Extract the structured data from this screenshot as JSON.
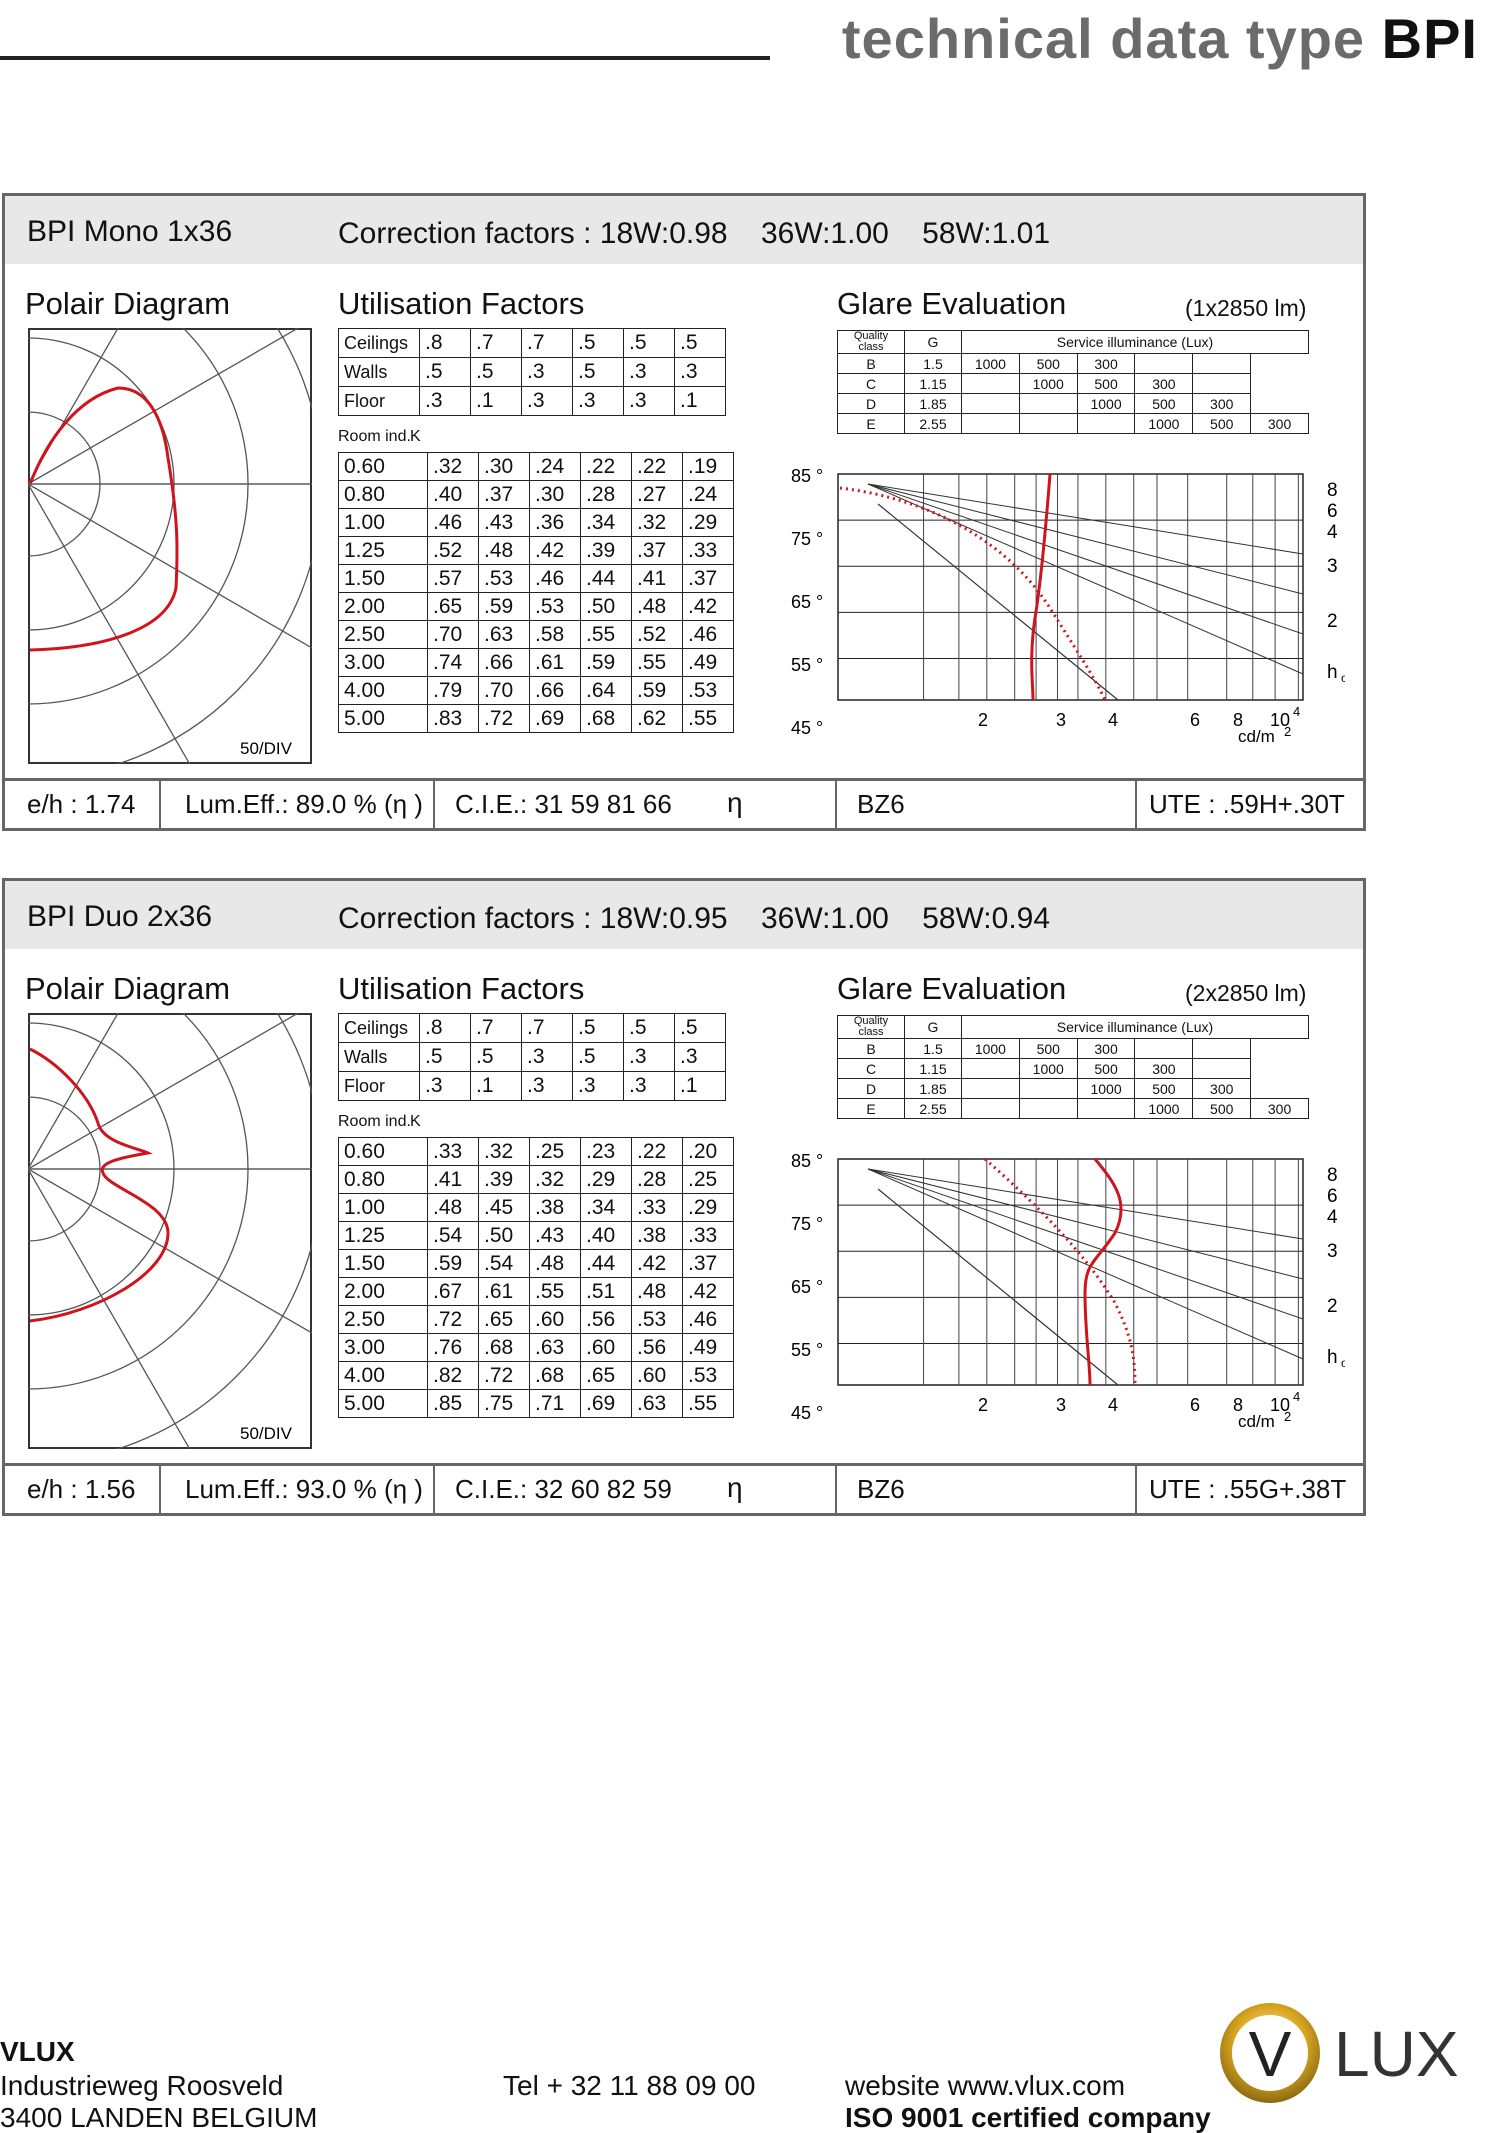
{
  "header": {
    "title_prefix": "technical data type",
    "title_bold": "BPI"
  },
  "panels": [
    {
      "name": "BPI Mono 1x36",
      "correction": "Correction factors : 18W:0.98    36W:1.00    58W:1.01",
      "polar_title": "Polair Diagram",
      "polar_scale": "50/DIV",
      "uf_title": "Utilisation Factors",
      "ceilings": [
        ".8",
        ".7",
        ".7",
        ".5",
        ".5",
        ".5"
      ],
      "walls": [
        ".5",
        ".5",
        ".3",
        ".5",
        ".3",
        ".3"
      ],
      "floor": [
        ".3",
        ".1",
        ".3",
        ".3",
        ".3",
        ".1"
      ],
      "rows": [
        {
          "k": "0.60",
          "v": [
            ".32",
            ".30",
            ".24",
            ".22",
            ".22",
            ".19"
          ]
        },
        {
          "k": "0.80",
          "v": [
            ".40",
            ".37",
            ".30",
            ".28",
            ".27",
            ".24"
          ]
        },
        {
          "k": "1.00",
          "v": [
            ".46",
            ".43",
            ".36",
            ".34",
            ".32",
            ".29"
          ]
        },
        {
          "k": "1.25",
          "v": [
            ".52",
            ".48",
            ".42",
            ".39",
            ".37",
            ".33"
          ]
        },
        {
          "k": "1.50",
          "v": [
            ".57",
            ".53",
            ".46",
            ".44",
            ".41",
            ".37"
          ]
        },
        {
          "k": "2.00",
          "v": [
            ".65",
            ".59",
            ".53",
            ".50",
            ".48",
            ".42"
          ]
        },
        {
          "k": "2.50",
          "v": [
            ".70",
            ".63",
            ".58",
            ".55",
            ".52",
            ".46"
          ]
        },
        {
          "k": "3.00",
          "v": [
            ".74",
            ".66",
            ".61",
            ".59",
            ".55",
            ".49"
          ]
        },
        {
          "k": "4.00",
          "v": [
            ".79",
            ".70",
            ".66",
            ".64",
            ".59",
            ".53"
          ]
        },
        {
          "k": "5.00",
          "v": [
            ".83",
            ".72",
            ".69",
            ".68",
            ".62",
            ".55"
          ]
        }
      ],
      "glare_title": "Glare Evaluation",
      "glare_lm": "(1x2850 lm)",
      "eh": "e/h : 1.74",
      "lumeff": "Lum.Eff.: 89.0 % (η )",
      "cie": "C.I.E.: 31 59 81 66",
      "eta": "η",
      "bz": "BZ6",
      "ute": "UTE : .59H+.30T"
    },
    {
      "name": "BPI Duo 2x36",
      "correction": "Correction factors : 18W:0.95    36W:1.00    58W:0.94",
      "polar_title": "Polair Diagram",
      "polar_scale": "50/DIV",
      "uf_title": "Utilisation Factors",
      "ceilings": [
        ".8",
        ".7",
        ".7",
        ".5",
        ".5",
        ".5"
      ],
      "walls": [
        ".5",
        ".5",
        ".3",
        ".5",
        ".3",
        ".3"
      ],
      "floor": [
        ".3",
        ".1",
        ".3",
        ".3",
        ".3",
        ".1"
      ],
      "rows": [
        {
          "k": "0.60",
          "v": [
            ".33",
            ".32",
            ".25",
            ".23",
            ".22",
            ".20"
          ]
        },
        {
          "k": "0.80",
          "v": [
            ".41",
            ".39",
            ".32",
            ".29",
            ".28",
            ".25"
          ]
        },
        {
          "k": "1.00",
          "v": [
            ".48",
            ".45",
            ".38",
            ".34",
            ".33",
            ".29"
          ]
        },
        {
          "k": "1.25",
          "v": [
            ".54",
            ".50",
            ".43",
            ".40",
            ".38",
            ".33"
          ]
        },
        {
          "k": "1.50",
          "v": [
            ".59",
            ".54",
            ".48",
            ".44",
            ".42",
            ".37"
          ]
        },
        {
          "k": "2.00",
          "v": [
            ".67",
            ".61",
            ".55",
            ".51",
            ".48",
            ".42"
          ]
        },
        {
          "k": "2.50",
          "v": [
            ".72",
            ".65",
            ".60",
            ".56",
            ".53",
            ".46"
          ]
        },
        {
          "k": "3.00",
          "v": [
            ".76",
            ".68",
            ".63",
            ".60",
            ".56",
            ".49"
          ]
        },
        {
          "k": "4.00",
          "v": [
            ".82",
            ".72",
            ".68",
            ".65",
            ".60",
            ".53"
          ]
        },
        {
          "k": "5.00",
          "v": [
            ".85",
            ".75",
            ".71",
            ".69",
            ".63",
            ".55"
          ]
        }
      ],
      "glare_title": "Glare Evaluation",
      "glare_lm": "(2x2850 lm)",
      "eh": "e/h : 1.56",
      "lumeff": "Lum.Eff.: 93.0 % (η )",
      "cie": "C.I.E.: 32 60 82 59",
      "eta": "η",
      "bz": "BZ6",
      "ute": "UTE : .55G+.38T"
    }
  ],
  "common": {
    "ceilings_label": "Ceilings",
    "walls_label": "Walls",
    "floor_label": "Floor",
    "room_index": "Room ind.",
    "k_label": "K",
    "ge_quality": "Quality class",
    "ge_g": "G",
    "ge_service": "Service illuminance (Lux)",
    "ge_rows": [
      {
        "c": "B",
        "g": "1.5",
        "a": "1000",
        "b": "500",
        "d": "300",
        "e": "",
        "f": ""
      },
      {
        "c": "C",
        "g": "1.15",
        "a": "",
        "b": "1000",
        "d": "500",
        "e": "300",
        "f": ""
      },
      {
        "c": "D",
        "g": "1.85",
        "a": "",
        "b": "",
        "d": "1000",
        "e": "500",
        "f": "300"
      },
      {
        "c": "E",
        "g": "2.55",
        "a": "",
        "b": "",
        "d": "",
        "e": "1000",
        "f": "500",
        "h": "300"
      }
    ],
    "angles": [
      "85 °",
      "75 °",
      "65 °",
      "55 °",
      "45 °"
    ],
    "x_ticks": [
      "2",
      "3",
      "4",
      "6",
      "8",
      "10"
    ],
    "x_exp": "4",
    "x_unit": "cd/m",
    "x_unit_exp": "2",
    "right_ticks": [
      "8",
      "6",
      "4",
      "3",
      "2",
      "h"
    ],
    "ho_sub": "o"
  },
  "footer": {
    "company": "VLUX",
    "street": "Industrieweg Roosveld",
    "city": "3400 LANDEN   BELGIUM",
    "tel": "Tel  + 32 11 88 09 00",
    "web": "website www.vlux.com",
    "iso": "ISO 9001 certified company",
    "logo_v": "V",
    "logo_text": "LUX"
  }
}
